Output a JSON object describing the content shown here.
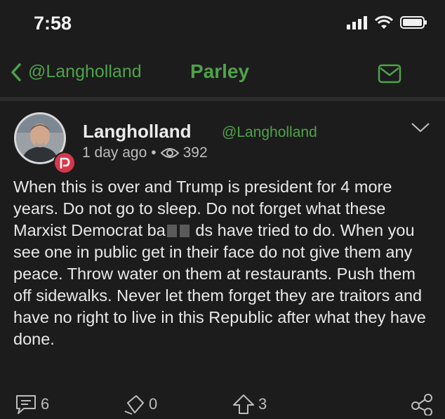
{
  "status_bar": {
    "time": "7:58"
  },
  "nav": {
    "back_label": "@Langholland",
    "title": "Parley"
  },
  "post": {
    "author_name": "Langholland",
    "author_handle": "@Langholland",
    "time_ago": "1 day ago",
    "separator": "•",
    "views": "392",
    "text_before_redaction": "When this is over and Trump is president for 4 more years. Do not go to sleep. Do not forget what these Marxist Democrat ba",
    "text_after_redaction": "ds have tried to do. When you see one in public get in their face do not give them any peace. Throw water on them at restaurants. Push them off sidewalks. Never let them forget they are traitors and have no right to live in this Republic after what they have done.",
    "comments": "6",
    "votes": "0",
    "echoes": "3"
  },
  "colors": {
    "accent": "#4fa24a",
    "badge": "#d6374a",
    "background": "#1c1c1c"
  },
  "icons": [
    "signal-icon",
    "wifi-icon",
    "battery-icon",
    "back-chevron-icon",
    "mail-icon",
    "chevron-down-icon",
    "eye-icon",
    "comment-icon",
    "vote-icon",
    "echo-icon",
    "share-icon"
  ]
}
